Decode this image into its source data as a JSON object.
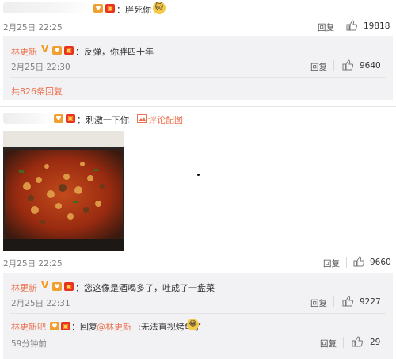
{
  "comment1": {
    "text": "：胖死你",
    "time": "2月25日 22:25",
    "reply_label": "回复",
    "likes": "19818"
  },
  "reply1": {
    "author": "林更新",
    "text": "：反弹，你胖四十年",
    "time": "2月25日 22:30",
    "reply_label": "回复",
    "likes": "9640",
    "more_replies": "共826条回复"
  },
  "comment2": {
    "text": "：刺激一下你",
    "image_link": "评论配图",
    "time": "2月25日 22:25",
    "reply_label": "回复",
    "likes": "9660"
  },
  "reply2": {
    "author": "林更新",
    "text": "：您这像是酒喝多了，吐成了一盘菜",
    "time": "2月25日 22:31",
    "reply_label": "回复",
    "likes": "9227"
  },
  "reply3": {
    "author": "林更新吧",
    "prefix": "：回复",
    "mention": "@林更新",
    "text": ":无法直视烤鱼了",
    "time": "59分钟前",
    "reply_label": "回复",
    "likes": "29"
  },
  "colors": {
    "accent": "#eb7350",
    "reply_bg": "#f2f2f5",
    "badge_gold": "#f39b1a",
    "badge_red": "#e8321e"
  },
  "icons": [
    "heart-badge-icon",
    "red-envelope-icon",
    "verified-v-icon",
    "cat-emoji-icon",
    "thumb-up-icon",
    "image-icon",
    "laugh-emoji-icon"
  ]
}
